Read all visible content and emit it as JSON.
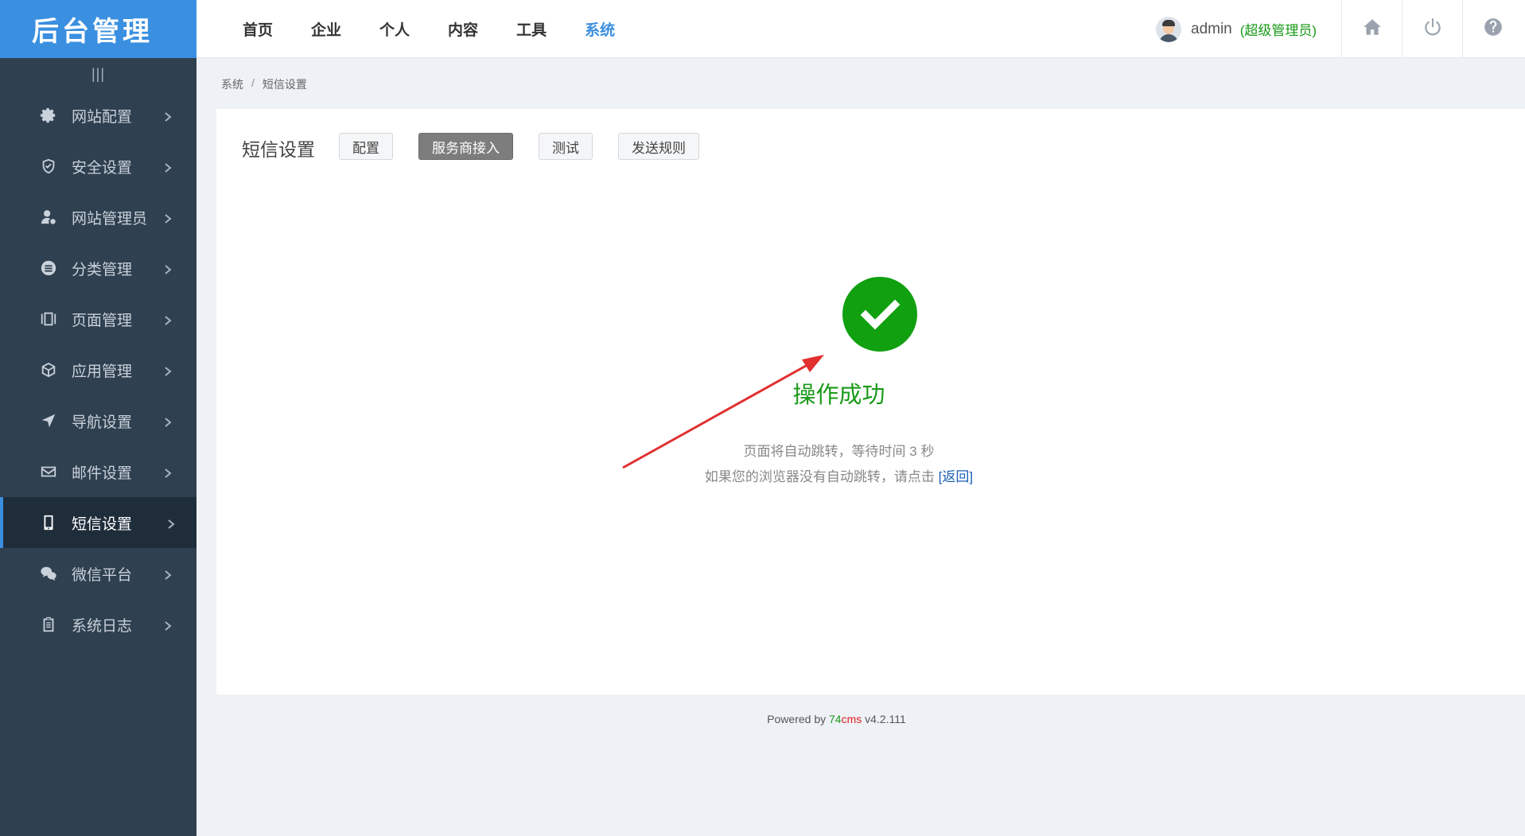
{
  "app": {
    "logo_text": "后台管理",
    "collapse_glyph": "|||"
  },
  "sidebar": {
    "items": [
      {
        "label": "网站配置",
        "icon": "gear-icon"
      },
      {
        "label": "安全设置",
        "icon": "shield-icon"
      },
      {
        "label": "网站管理员",
        "icon": "admin-user-icon"
      },
      {
        "label": "分类管理",
        "icon": "list-circle-icon"
      },
      {
        "label": "页面管理",
        "icon": "pages-icon"
      },
      {
        "label": "应用管理",
        "icon": "cube-icon"
      },
      {
        "label": "导航设置",
        "icon": "navigation-arrow-icon"
      },
      {
        "label": "邮件设置",
        "icon": "mail-icon"
      },
      {
        "label": "短信设置",
        "icon": "mobile-phone-icon",
        "active": true
      },
      {
        "label": "微信平台",
        "icon": "wechat-icon"
      },
      {
        "label": "系统日志",
        "icon": "clipboard-icon"
      }
    ]
  },
  "topnav": {
    "items": [
      {
        "label": "首页"
      },
      {
        "label": "企业"
      },
      {
        "label": "个人"
      },
      {
        "label": "内容"
      },
      {
        "label": "工具"
      },
      {
        "label": "系统",
        "active": true
      }
    ]
  },
  "user": {
    "name": "admin",
    "role": "(超级管理员)"
  },
  "top_icons": [
    "home-icon",
    "power-icon",
    "help-icon"
  ],
  "breadcrumb": {
    "parent": "系统",
    "separator": "/",
    "current": "短信设置"
  },
  "page": {
    "title": "短信设置",
    "tabs": [
      {
        "label": "配置"
      },
      {
        "label": "服务商接入",
        "active": true
      },
      {
        "label": "测试"
      },
      {
        "label": "发送规则"
      }
    ]
  },
  "result": {
    "icon": "check-circle-icon",
    "title": "操作成功",
    "message_line1": "页面将自动跳转，等待时间 3 秒",
    "message_line2_prefix": "如果您的浏览器没有自动跳转，请点击 ",
    "back_link": "[返回]"
  },
  "annotation": {
    "icon": "red-arrow-icon"
  },
  "footer": {
    "prefix": "Powered by ",
    "brand_part1": "74",
    "brand_part2": "cms",
    "version": " v4.2.111"
  },
  "colors": {
    "accent": "#3a8fe0",
    "sidebar_bg": "#2f4050",
    "success": "#10a010",
    "role_green": "#1a9a1a",
    "arrow_red": "#e03030"
  }
}
